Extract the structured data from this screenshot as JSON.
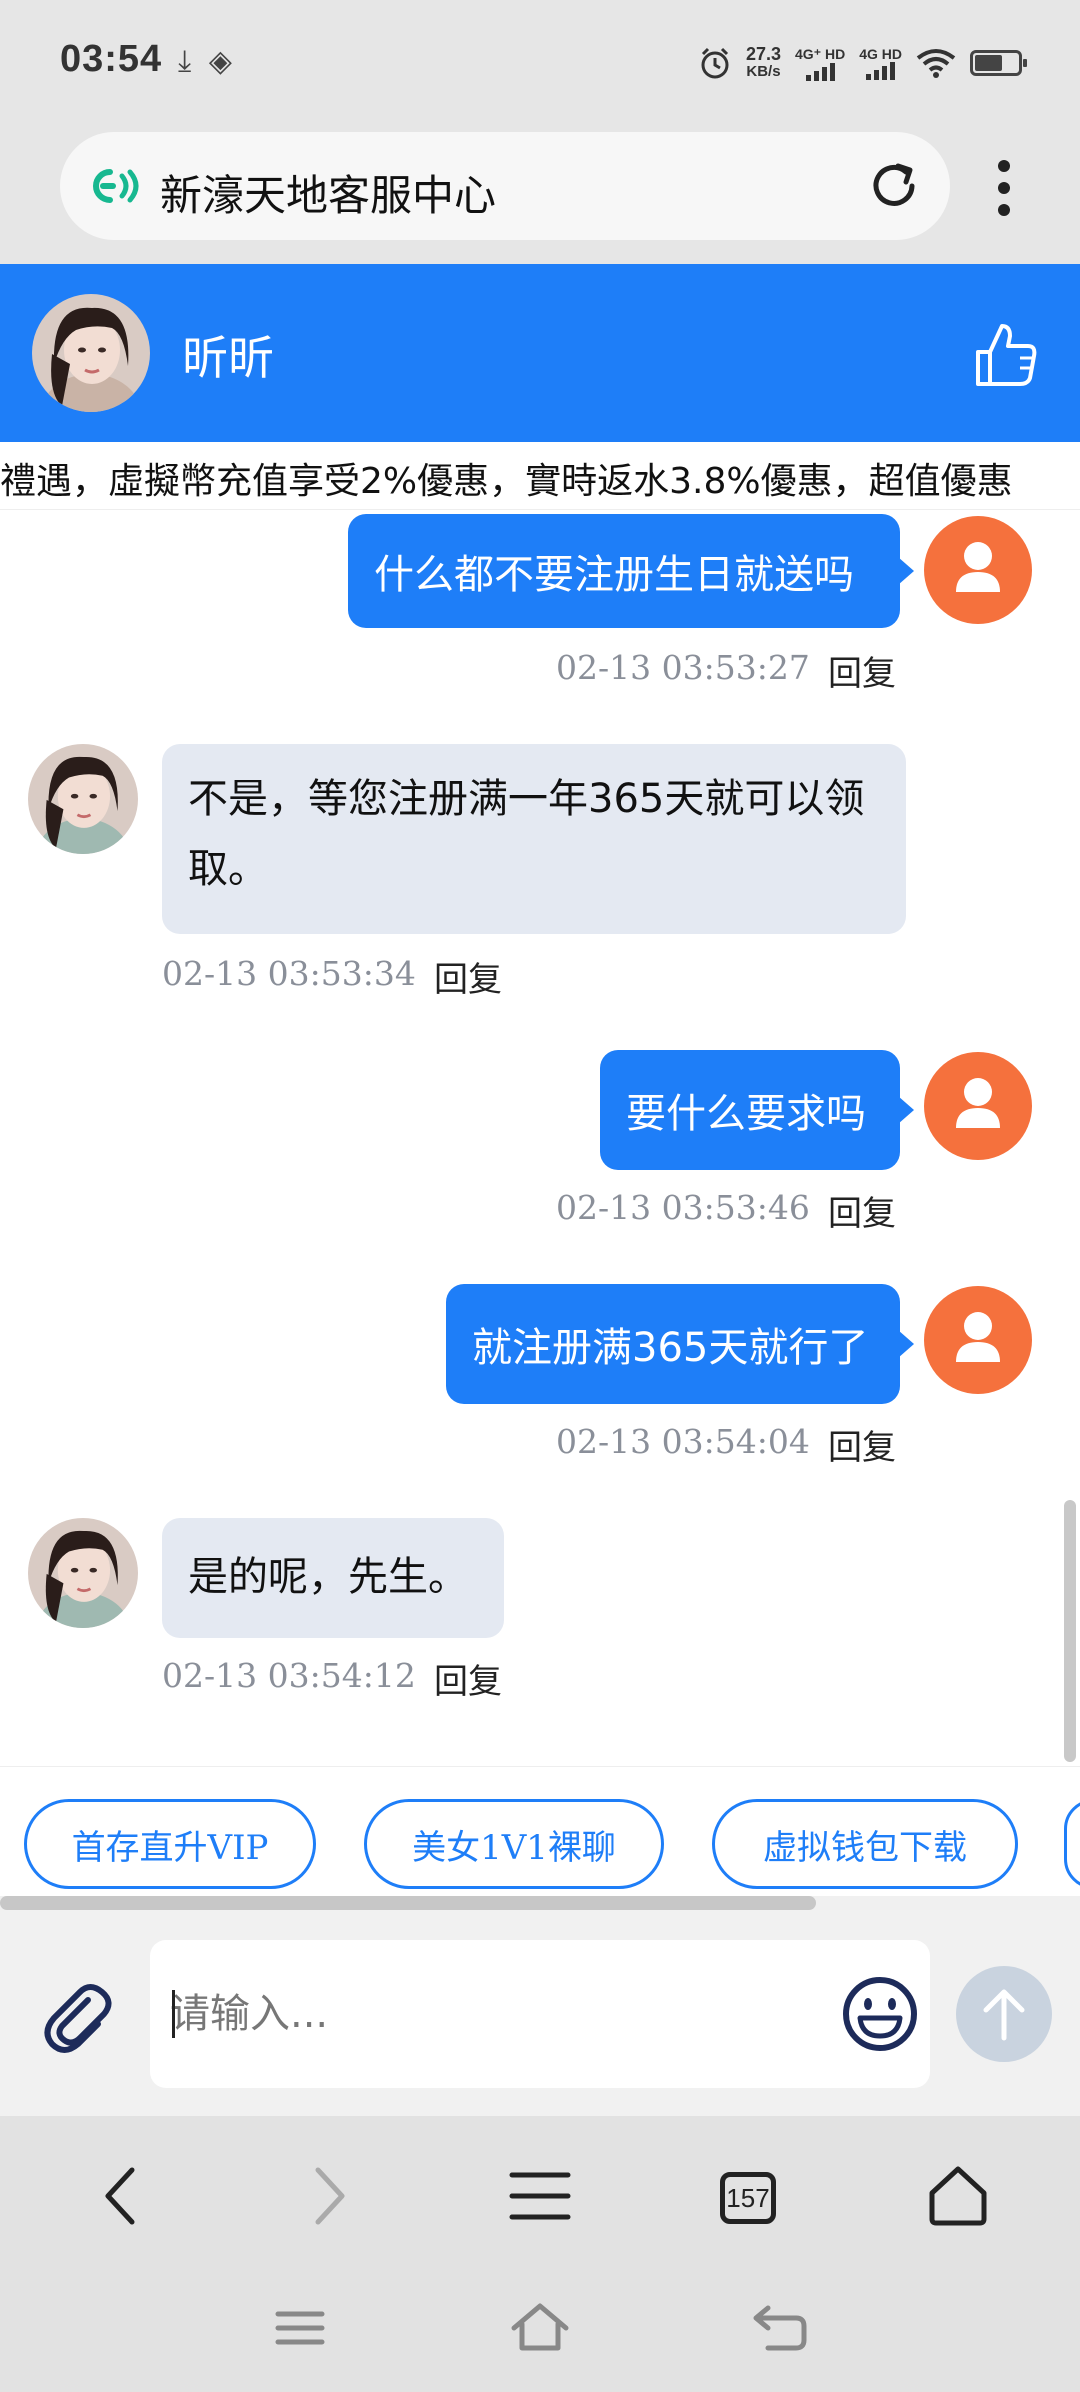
{
  "status_bar": {
    "time": "03:54",
    "net_speed_value": "27.3",
    "net_speed_unit": "KB/s",
    "signal1_label": "4G⁺ HD",
    "signal2_label": "4G HD",
    "battery_level": 0.65
  },
  "browser": {
    "site_title": "新濠天地客服中心"
  },
  "chat_header": {
    "agent_name": "昕昕"
  },
  "marquee": {
    "text": "禮遇，虛擬幣充值享受2%優惠，實時返水3.8%優惠，超值優惠"
  },
  "messages": [
    {
      "side": "out",
      "text": "什么都不要注册生日就送吗",
      "time": "02-13 03:53:27",
      "reply": "回复"
    },
    {
      "side": "in",
      "text": "不是，等您注册满一年365天就可以领取。",
      "time": "02-13 03:53:34",
      "reply": "回复"
    },
    {
      "side": "out",
      "text": "要什么要求吗",
      "time": "02-13 03:53:46",
      "reply": "回复"
    },
    {
      "side": "out",
      "text": "就注册满365天就行了",
      "time": "02-13 03:54:04",
      "reply": "回复"
    },
    {
      "side": "in",
      "text": "是的呢，先生。",
      "time": "02-13 03:54:12",
      "reply": "回复"
    }
  ],
  "quick_replies": [
    "首存直升VIP",
    "美女1V1裸聊",
    "虚拟钱包下载"
  ],
  "input": {
    "placeholder": "请输入..."
  },
  "browser_nav": {
    "tab_count": "157"
  },
  "colors": {
    "primary": "#1e7ef8",
    "user_avatar": "#f5713d",
    "incoming_bubble": "#e4e9f2"
  }
}
